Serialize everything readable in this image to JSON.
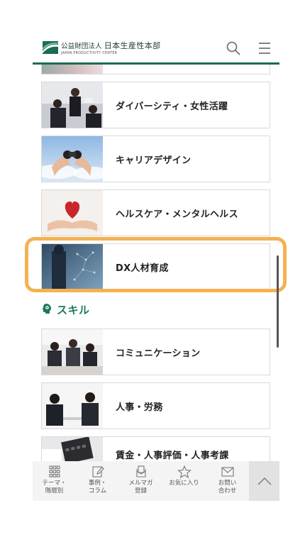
{
  "header": {
    "logo_prefix": "公益財団法人",
    "logo_name": "日本生産性本部",
    "logo_en": "JAPAN PRODUCTIVITY CENTER"
  },
  "cards": [
    {
      "label": "ダイバーシティ・女性活躍",
      "thumb": "business-team-photo"
    },
    {
      "label": "キャリアデザイン",
      "thumb": "binoculars-photo"
    },
    {
      "label": "ヘルスケア・メンタルヘルス",
      "thumb": "heart-hands-photo"
    },
    {
      "label": "DX人材育成",
      "thumb": "digital-network-photo"
    }
  ],
  "section": {
    "label": "スキル",
    "icon": "head-gear-icon"
  },
  "skill_cards": [
    {
      "label": "コミュニケーション",
      "thumb": "meeting-photo"
    },
    {
      "label": "人事・労務",
      "thumb": "interview-photo"
    },
    {
      "label": "賃金・人事評価・人事考課",
      "thumb": "calculator-photo"
    }
  ],
  "bottom_nav": [
    {
      "label": "テーマ・\n階層別",
      "icon": "grid-icon"
    },
    {
      "label": "事例・\nコラム",
      "icon": "edit-icon"
    },
    {
      "label": "メルマガ\n登録",
      "icon": "newsletter-icon"
    },
    {
      "label": "お気に入り",
      "icon": "star-icon"
    },
    {
      "label": "お問い\n合わせ",
      "icon": "mail-icon"
    }
  ],
  "colors": {
    "accent": "#1b7d57",
    "highlight": "#f4b252",
    "header_line": "#1b6b57"
  }
}
